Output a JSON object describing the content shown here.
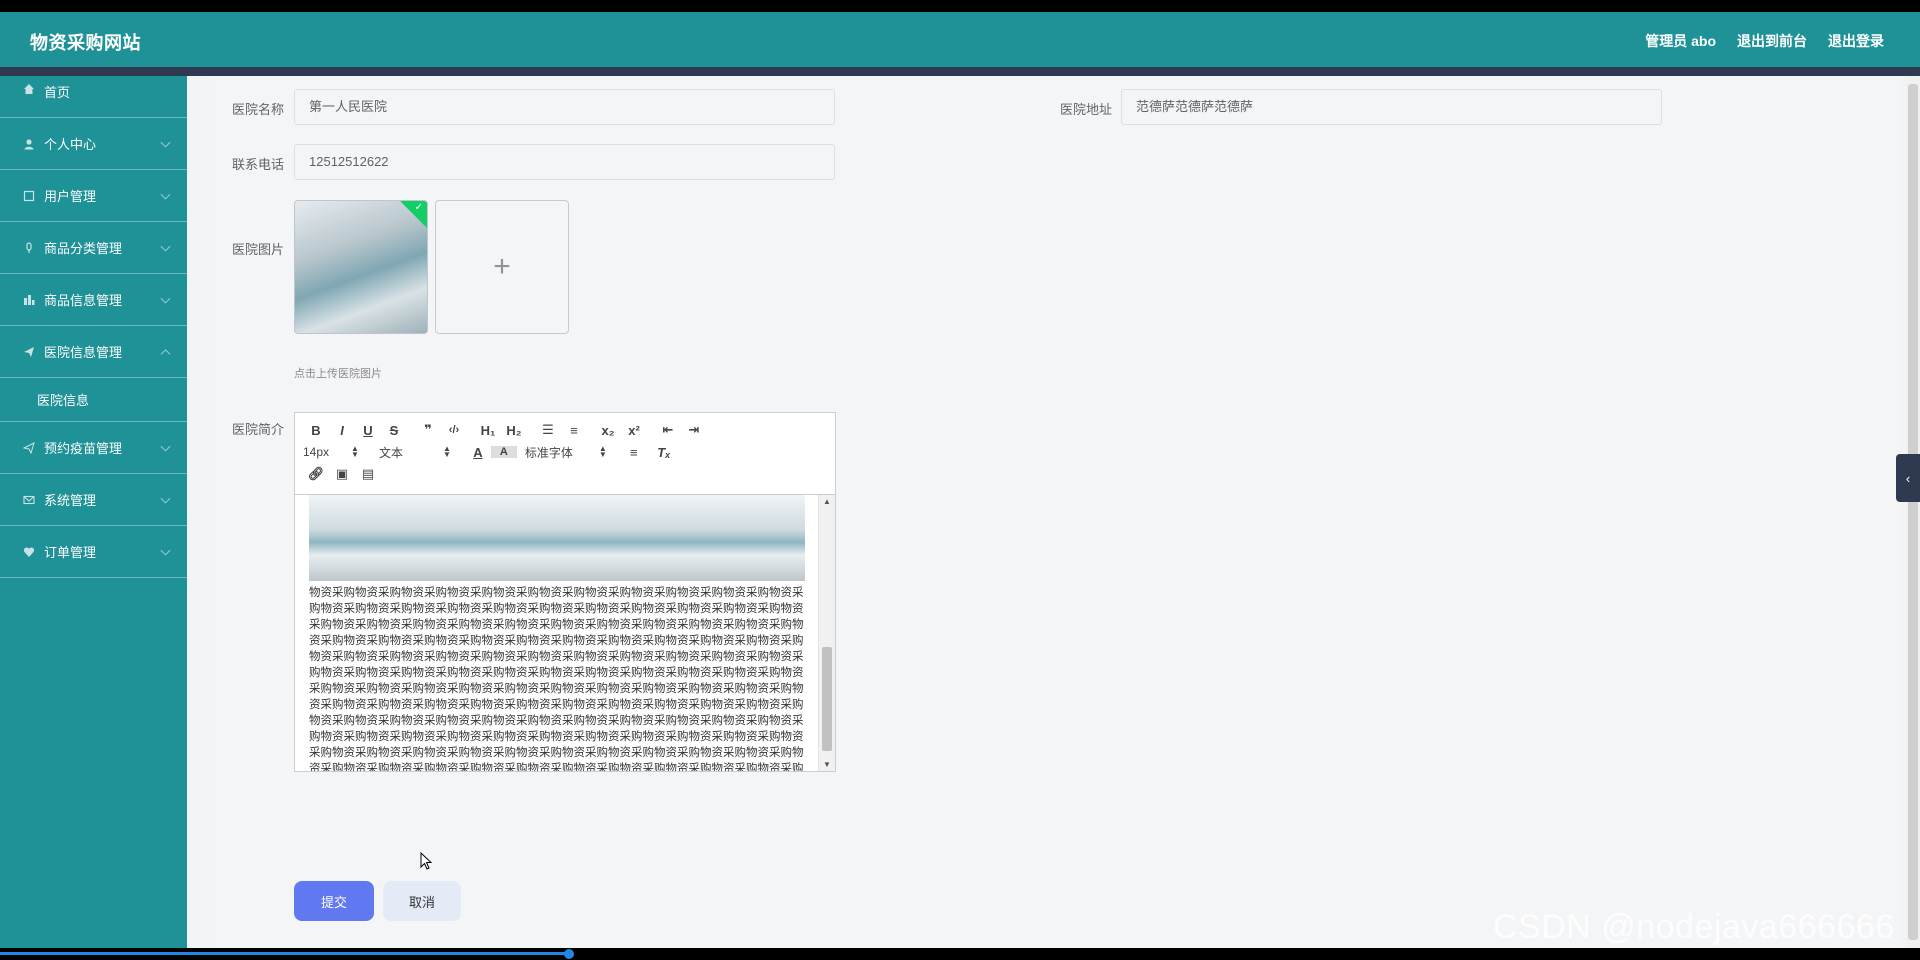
{
  "header": {
    "title": "物资采购网站",
    "admin_label": "管理员 abo",
    "front_link": "退出到前台",
    "logout_link": "退出登录"
  },
  "sidebar": {
    "items": [
      {
        "label": "首页",
        "icon": "home-icon"
      },
      {
        "label": "个人中心",
        "icon": "user-icon"
      },
      {
        "label": "用户管理",
        "icon": "square-icon"
      },
      {
        "label": "商品分类管理",
        "icon": "mic-icon"
      },
      {
        "label": "商品信息管理",
        "icon": "chart-icon"
      },
      {
        "label": "医院信息管理",
        "icon": "send-icon"
      },
      {
        "label": "预约疫苗管理",
        "icon": "send-icon"
      },
      {
        "label": "系统管理",
        "icon": "mail-icon"
      },
      {
        "label": "订单管理",
        "icon": "heart-icon"
      }
    ],
    "sub_items": [
      {
        "label": "医院信息"
      }
    ]
  },
  "form": {
    "name_label": "医院名称",
    "name_value": "第一人民医院",
    "address_label": "医院地址",
    "address_value": "范德萨范德萨范德萨",
    "phone_label": "联系电话",
    "phone_value": "12512512622",
    "image_label": "医院图片",
    "upload_tip": "点击上传医院图片",
    "intro_label": "医院简介"
  },
  "editor": {
    "font_size": "14px",
    "text_style": "文本",
    "font_family": "标准字体",
    "content_text": "物资采购物资采购物资采购物资采购物资采购物资采购物资采购物资采购物资采购物资采购物资采购物资采购物资采购物资采购物资采购物资采购物资采购物资采购物资采购物资采购物资采购物资采购物资采购物资采购物资采购物资采购物资采购物资采购物资采购物资采购物资采购物资采购物资采购物资采购物资采购物资采购物资采购物资采购物资采购物资采购物资采购物资采购物资采购物资采购物资采购物资采购物资采购物资采购物资采购物资采购物资采购物资采购物资采购物资采购物资采购物资采购物资采购物资采购物资采购物资采购物资采购物资采购物资采购物资采购物资采购物资采购物资采购物资采购物资采购物资采购物资采购物资采购物资采购物资采购物资采购物资采购物资采购物资采购物资采购物资采购物资采购物资采购物资采购物资采购物资采购物资采购物资采购物资采购物资采购物资采购物资采购物资采购物资采购物资采购物资采购物资采购物资采购物资采购物资采购物资采购物资采购物资采购物资采购物资采购物资采购物资采购物资采购物资采购物资采购物资采购物资采购物资采购物资采购物资采购物资采购物资采购物资采购物资采购物资采购物资采购物资采购物资采购物资采购物资采购物资采购物资采购物资采购物资采购物资采购物资采购物资采购物资采购物资采购物资采购物资采购物资采购物资采购物资采购物资采购物资采购物资采购物资采购物资采购物资采购物资采购物资采购物资采购物资采购物资采购物资采购物资采购物资采购物资采购物资采购物资采购物资采购物资采购物资采购物资采购物资采购物资采购物资采购物资采购物资采购物资采购物资采购物资采购物资采购物资采购物资采购物资采购物资采购物资采购物资采购物资采购物资采购物资采购物资采购物资采购物资采购物资采购物资采购物资采购物资采购物资采购物资采购物资采购物资采购物资采购物资采购物资采购物资采购物资采购物资采购物资采购物资采购物资采购物资采购物资采购物资采购物资采购物资采购物资采购物资采购物资采购物资采购物资采购物资采购物资采购物资采购物资采购物资采购物资采购物资采购物资采购物资采购物资采购物资采购物资采购"
  },
  "buttons": {
    "submit": "提交",
    "cancel": "取消"
  },
  "watermark": "CSDN @nodejava666666",
  "colors": {
    "brand": "#1f9298",
    "primary_button": "#6079f0",
    "header_bar": "#2f3a50"
  }
}
